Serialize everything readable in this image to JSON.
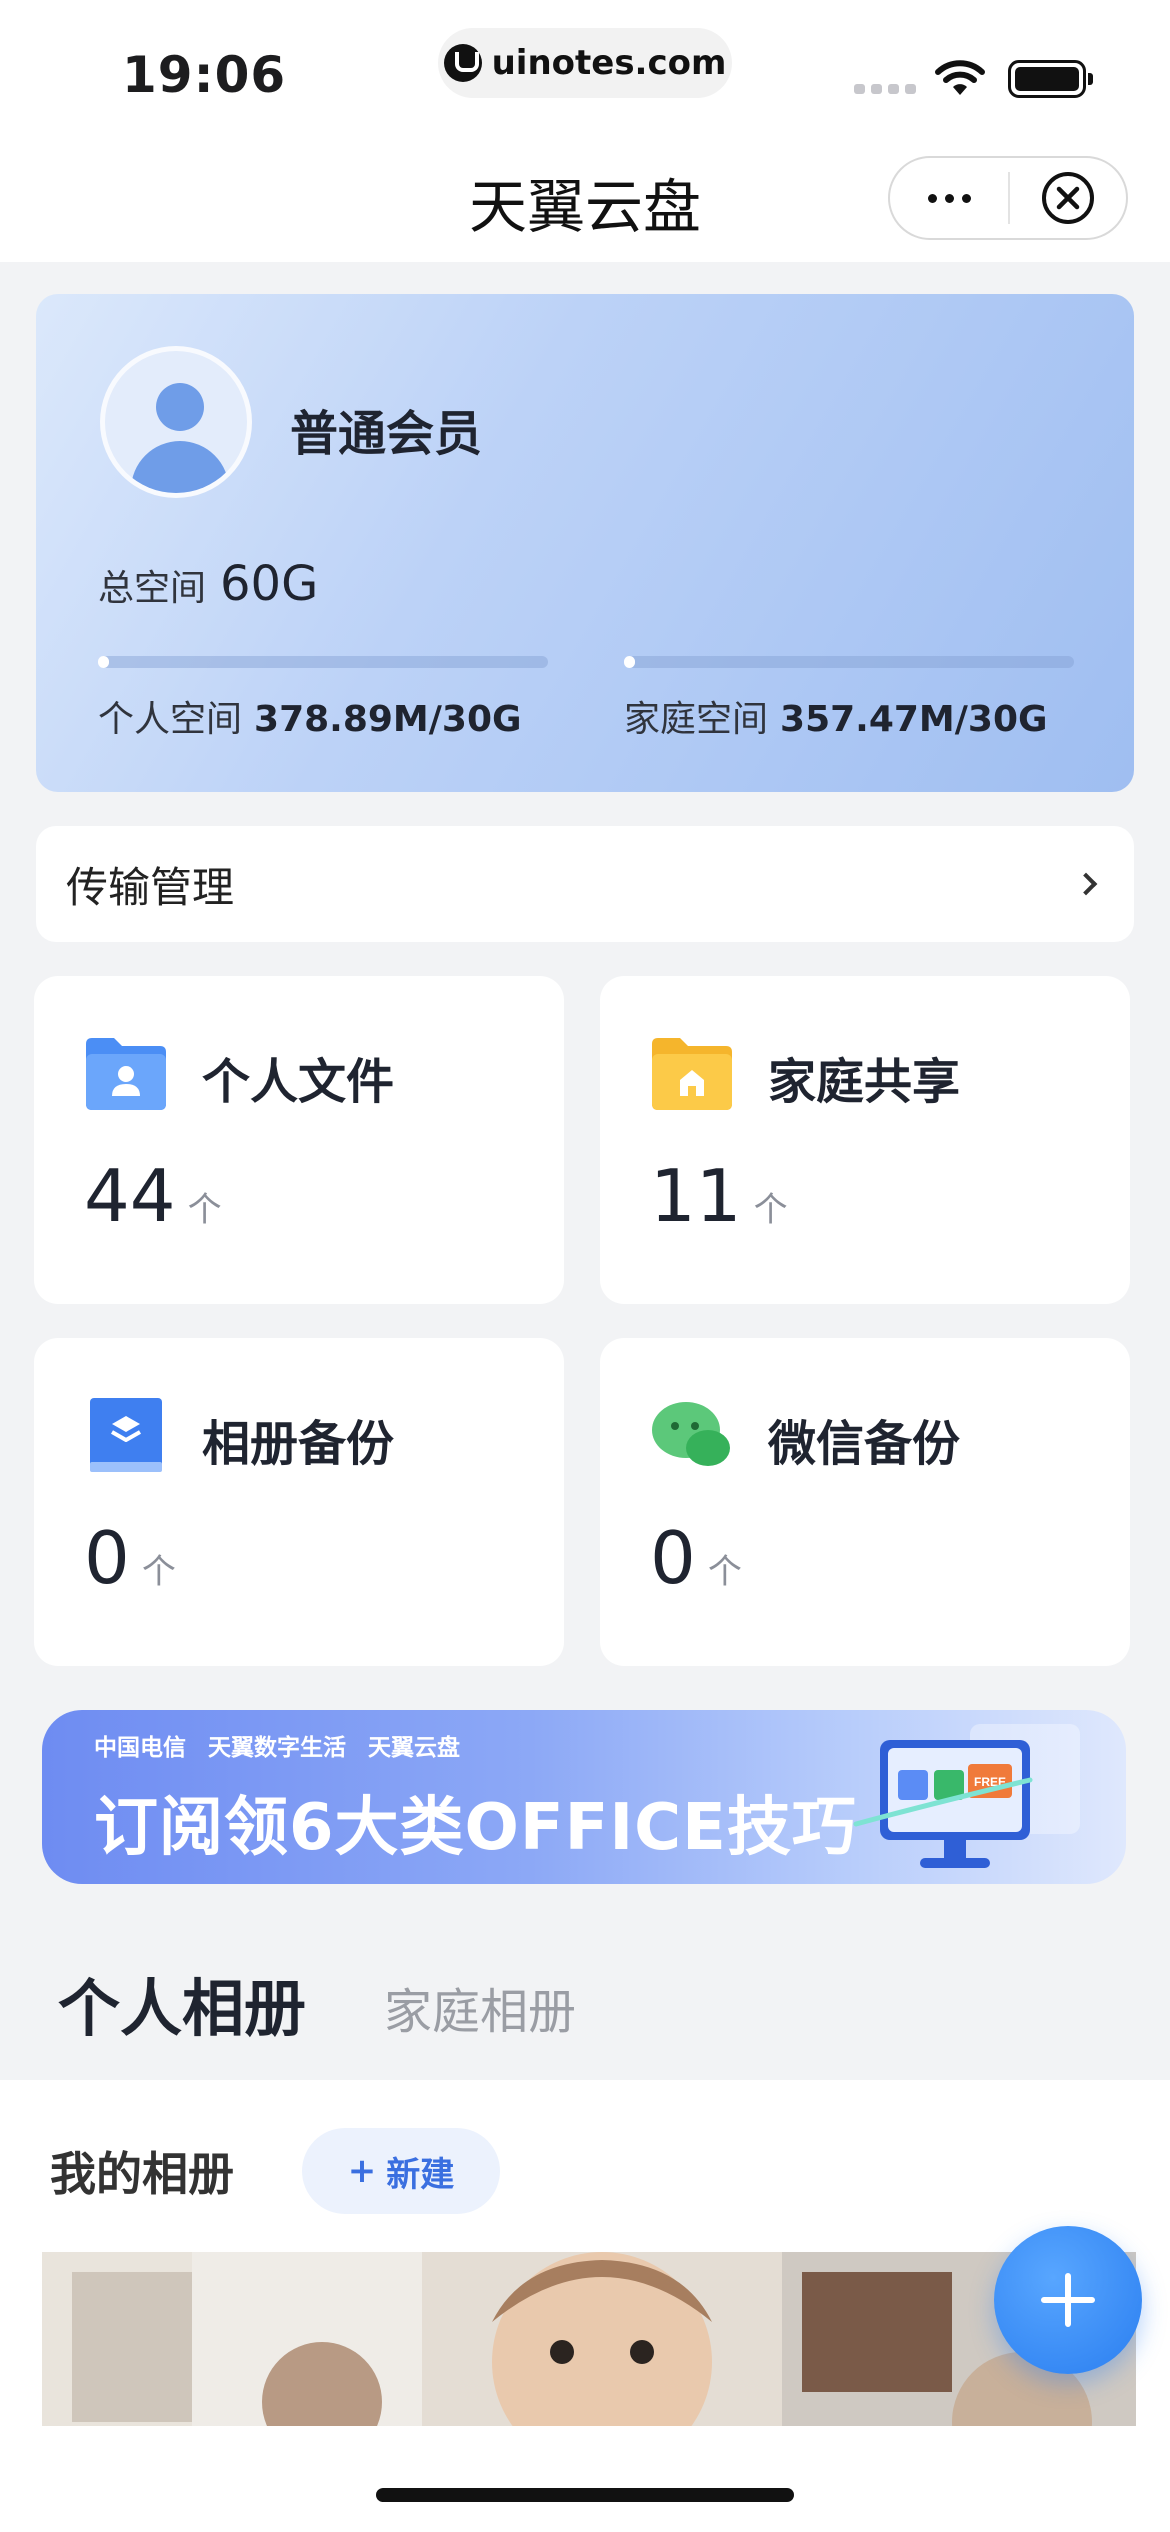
{
  "status_bar": {
    "time": "19:06",
    "url": "uinotes.com"
  },
  "nav": {
    "title": "天翼云盘"
  },
  "member": {
    "level": "普通会员",
    "total_label": "总空间",
    "total_value": "60G",
    "personal_label": "个人空间",
    "personal_value": "378.89M/30G",
    "personal_fraction": 0.012,
    "family_label": "家庭空间",
    "family_value": "357.47M/30G",
    "family_fraction": 0.012
  },
  "transfer": {
    "label": "传输管理"
  },
  "cards": {
    "personal": {
      "title": "个人文件",
      "count": "44",
      "unit": "个"
    },
    "family": {
      "title": "家庭共享",
      "count": "11",
      "unit": "个"
    },
    "album": {
      "title": "相册备份",
      "count": "0",
      "unit": "个"
    },
    "wechat": {
      "title": "微信备份",
      "count": "0",
      "unit": "个"
    }
  },
  "banner": {
    "brands": [
      "中国电信",
      "天翼数字生活",
      "天翼云盘"
    ],
    "text": "订阅领6大类OFFICE技巧",
    "art_label": "FREE"
  },
  "album_tabs": {
    "personal": "个人相册",
    "family": "家庭相册"
  },
  "my_album": {
    "title": "我的相册",
    "new_label": "新建",
    "new_prefix": "+"
  },
  "colors": {
    "accent": "#2a7ef0",
    "card_bg": "#ffffff",
    "page_bg": "#f2f3f5"
  },
  "icons": {
    "status": [
      "uinotes-logo-icon",
      "signal-icon",
      "wifi-icon",
      "battery-icon"
    ],
    "nav": [
      "more-icon",
      "close-icon"
    ],
    "cards": [
      "person-folder-icon",
      "home-folder-icon",
      "album-icon",
      "wechat-icon"
    ],
    "fab": "plus-icon"
  }
}
